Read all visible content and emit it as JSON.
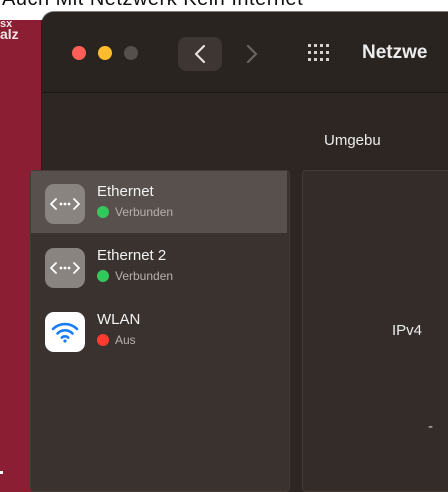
{
  "background": {
    "top_text": "Auch Mit Netzwerk Kein Internet",
    "desktop_label_line1": "sx",
    "desktop_label_line2": "alz"
  },
  "window": {
    "title": "Netzwe",
    "traffic_lights": [
      "close",
      "minimize",
      "zoom"
    ],
    "colors": {
      "close": "#ff5f57",
      "minimize": "#febc2e",
      "zoom": "#55504c"
    }
  },
  "toolbar": {
    "back_icon": "chevron-left-icon",
    "forward_icon": "chevron-right-icon",
    "grid_icon": "grid-icon"
  },
  "location": {
    "label": "Umgebu"
  },
  "services": [
    {
      "name": "Ethernet",
      "status": "Verbunden",
      "status_color": "#34c759",
      "icon": "ethernet-icon",
      "selected": true
    },
    {
      "name": "Ethernet 2",
      "status": "Verbunden",
      "status_color": "#34c759",
      "icon": "ethernet-icon",
      "selected": false
    },
    {
      "name": "WLAN",
      "status": "Aus",
      "status_color": "#ff3b30",
      "icon": "wifi-icon",
      "selected": false
    }
  ],
  "detail": {
    "ipv4_label": "IPv4",
    "stray": "-"
  }
}
